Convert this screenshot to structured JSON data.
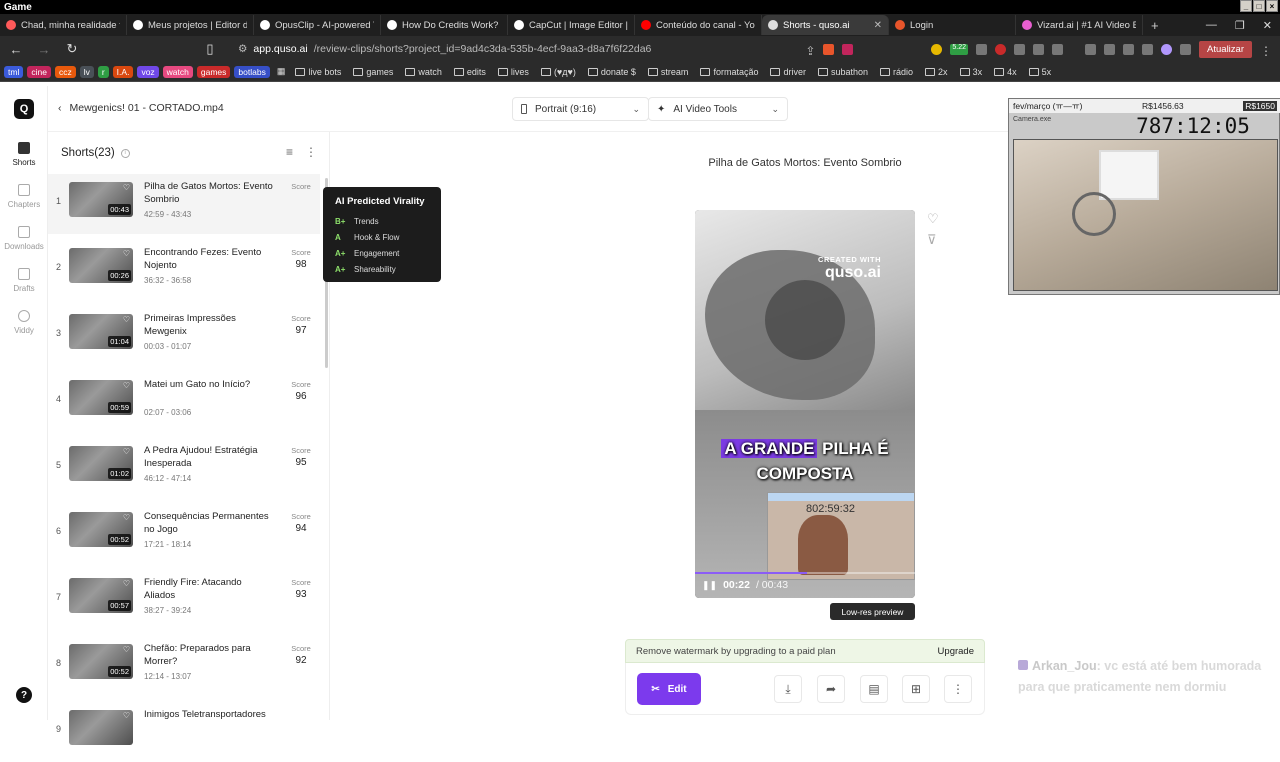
{
  "os": {
    "title": "Game"
  },
  "tabs": [
    {
      "title": "Chad, minha realidade fin",
      "color": "#ff5a5a",
      "active": false
    },
    {
      "title": "Meus projetos | Editor de",
      "color": "#ffffff",
      "active": false
    },
    {
      "title": "OpusClip - AI-powered Vi",
      "color": "#ffffff",
      "active": false
    },
    {
      "title": "How Do Credits Work? - O",
      "color": "#ffffff",
      "active": false
    },
    {
      "title": "CapCut | Image Editor | AI",
      "color": "#ffffff",
      "active": false
    },
    {
      "title": "Conteúdo do canal - YouT",
      "color": "#ff0000",
      "active": false
    },
    {
      "title": "Shorts - quso.ai",
      "color": "#dddddd",
      "active": true
    },
    {
      "title": "Login",
      "color": "#e8552b",
      "active": false
    },
    {
      "title": "Vizard.ai | #1 AI Video Edit",
      "color": "#e85fd0",
      "active": false
    }
  ],
  "address": {
    "host": "app.quso.ai",
    "path": "/review-clips/shorts?project_id=9ad4c3da-535b-4ecf-9aa3-d8a7f6f22da6",
    "update_label": "Atualizar",
    "badge": "5.22"
  },
  "bookmarks_chips": [
    {
      "label": "tml",
      "color": "#3b5bdb"
    },
    {
      "label": "cine",
      "color": "#c2255c"
    },
    {
      "label": "ccz",
      "color": "#e8590c"
    },
    {
      "label": "lv",
      "color": "#495057"
    },
    {
      "label": "r",
      "color": "#2f9e44"
    },
    {
      "label": "I.A.",
      "color": "#d9480f"
    },
    {
      "label": "voz",
      "color": "#7048e8"
    },
    {
      "label": "watch",
      "color": "#e64980"
    },
    {
      "label": "games",
      "color": "#c92a2a"
    },
    {
      "label": "botlabs",
      "color": "#364fc7"
    }
  ],
  "bookmarks": [
    "live bots",
    "games",
    "watch",
    "edits",
    "lives",
    "(♥д♥)",
    "donate $",
    "stream",
    "formatação",
    "driver",
    "subathon",
    "rádio",
    "2x",
    "3x",
    "4x",
    "5x"
  ],
  "rail": {
    "shorts": "Shorts",
    "chapters": "Chapters",
    "downloads": "Downloads",
    "drafts": "Drafts",
    "viddy": "Viddy"
  },
  "topbar": {
    "back": "‹",
    "filename": "Mewgenics! 01 - CORTADO.mp4",
    "aspect": "Portrait (9:16)",
    "tools": "AI Video Tools"
  },
  "list": {
    "header": "Shorts(23)",
    "score_label": "Score",
    "items": [
      {
        "n": "1",
        "title": "Pilha de Gatos Mortos: Evento Sombrio",
        "range": "42:59 - 43:43",
        "dur": "00:43",
        "score": ""
      },
      {
        "n": "2",
        "title": "Encontrando Fezes: Evento Nojento",
        "range": "36:32 - 36:58",
        "dur": "00:26",
        "score": "98"
      },
      {
        "n": "3",
        "title": "Primeiras Impressões Mewgenix",
        "range": "00:03 - 01:07",
        "dur": "01:04",
        "score": "97"
      },
      {
        "n": "4",
        "title": "Matei um Gato no Início?",
        "range": "02:07 - 03:06",
        "dur": "00:59",
        "score": "96"
      },
      {
        "n": "5",
        "title": "A Pedra Ajudou! Estratégia Inesperada",
        "range": "46:12 - 47:14",
        "dur": "01:02",
        "score": "95"
      },
      {
        "n": "6",
        "title": "Consequências Permanentes no Jogo",
        "range": "17:21 - 18:14",
        "dur": "00:52",
        "score": "94"
      },
      {
        "n": "7",
        "title": "Friendly Fire: Atacando Aliados",
        "range": "38:27 - 39:24",
        "dur": "00:57",
        "score": "93"
      },
      {
        "n": "8",
        "title": "Chefão: Preparados para Morrer?",
        "range": "12:14 - 13:07",
        "dur": "00:52",
        "score": "92"
      },
      {
        "n": "9",
        "title": "Inimigos Teletransportadores",
        "range": "",
        "dur": "",
        "score": ""
      }
    ]
  },
  "tooltip": {
    "title": "AI Predicted Virality",
    "rows": [
      {
        "grade": "B+",
        "label": "Trends"
      },
      {
        "grade": "A",
        "label": "Hook & Flow"
      },
      {
        "grade": "A+",
        "label": "Engagement"
      },
      {
        "grade": "A+",
        "label": "Shareability"
      }
    ]
  },
  "preview": {
    "title": "Pilha de Gatos Mortos: Evento Sombrio",
    "watermark_top": "CREATED WITH",
    "watermark_brand": "quso.ai",
    "caption_hl": "A GRANDE",
    "caption_rest": "PILHA É",
    "caption_line2": "COMPOSTA",
    "inset_clock": "802:59:32",
    "current": "00:22",
    "total": "/ 00:43",
    "progress": 0.51,
    "lowres": "Low-res preview"
  },
  "upgrade": {
    "text": "Remove watermark by upgrading to a paid plan",
    "cta": "Upgrade"
  },
  "actions": {
    "edit": "Edit"
  },
  "overlay": {
    "left_label": "fev/março (ㅠ—ㅠ)",
    "money1": "R$1456.63",
    "money2": "R$1650",
    "clock": "787:12:05",
    "camera_label": "Camera.exe"
  },
  "chat": {
    "user": "Arkan_Jou",
    "message": ": vc está até bem humorada para que praticamente nem dormiu"
  },
  "colors": {
    "accent": "#7c3aed",
    "grade_green": "#8ee06b"
  }
}
